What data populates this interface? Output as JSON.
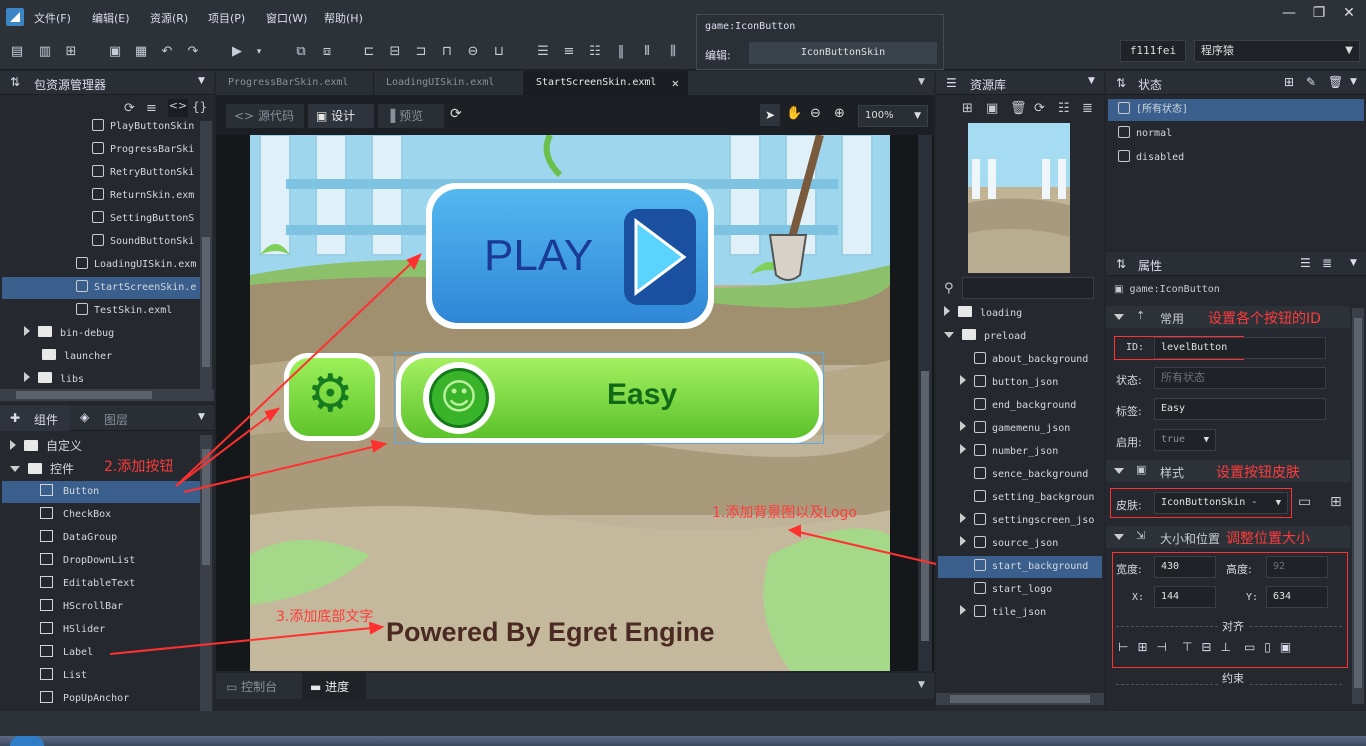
{
  "menu": {
    "items": [
      "文件(F)",
      "编辑(E)",
      "资源(R)",
      "项目(P)",
      "窗口(W)",
      "帮助(H)"
    ]
  },
  "toolbar": {
    "user": "f111fei",
    "role": "程序猿"
  },
  "tooltip": {
    "title": "game:IconButton",
    "label": "编辑:",
    "value": "IconButtonSkin"
  },
  "left_panel": {
    "title": "包资源管理器",
    "files": [
      "PlayButtonSkin",
      "ProgressBarSki",
      "RetryButtonSki",
      "ReturnSkin.exm",
      "SettingButtonS",
      "SoundButtonSki",
      "LoadingUISkin.exm",
      "StartScreenSkin.e",
      "TestSkin.exml"
    ],
    "folders": [
      "bin-debug",
      "launcher",
      "libs"
    ]
  },
  "components_panel": {
    "tab1": "组件",
    "tab2": "图层",
    "groups": [
      "自定义",
      "控件"
    ],
    "items": [
      "Button",
      "CheckBox",
      "DataGroup",
      "DropDownList",
      "EditableText",
      "HScrollBar",
      "HSlider",
      "Label",
      "List",
      "PopUpAnchor"
    ]
  },
  "editor": {
    "tabs": [
      "ProgressBarSkin.exml",
      "LoadingUISkin.exml",
      "StartScreenSkin.exml"
    ],
    "mode_source": "源代码",
    "mode_design": "设计",
    "mode_preview": "预览",
    "zoom": "100%",
    "canvas": {
      "play_label": "PLAY",
      "easy_label": "Easy",
      "footer": "Powered By Egret Engine"
    },
    "bottom_tabs": [
      "控制台",
      "进度"
    ]
  },
  "annotations": {
    "add_button": "2.添加按钮",
    "add_bg": "1.添加背景图以及Logo",
    "add_text": "3.添加底部文字",
    "set_id": "设置各个按钮的ID",
    "set_skin": "设置按钮皮肤",
    "adjust": "调整位置大小"
  },
  "assets_panel": {
    "title": "资源库",
    "folders": [
      "loading",
      "preload"
    ],
    "items": [
      "about_background",
      "button_json",
      "end_background",
      "gamemenu_json",
      "number_json",
      "sence_background",
      "setting_backgroun",
      "settingscreen_jso",
      "source_json",
      "start_background",
      "start_logo",
      "tile_json"
    ]
  },
  "states_panel": {
    "title": "状态",
    "states": [
      "[所有状态]",
      "normal",
      "disabled"
    ]
  },
  "props_panel": {
    "title": "属性",
    "component": "game:IconButton",
    "section_common": "常用",
    "id_label": "ID:",
    "id_value": "levelButton",
    "state_label": "状态:",
    "state_placeholder": "所有状态",
    "label_label": "标签:",
    "label_value": "Easy",
    "enabled_label": "启用:",
    "enabled_value": "true",
    "section_style": "样式",
    "skin_label": "皮肤:",
    "skin_value": "IconButtonSkin -",
    "section_size": "大小和位置",
    "width_label": "宽度:",
    "width_value": "430",
    "height_label": "高度:",
    "height_value": "92",
    "x_label": "X:",
    "x_value": "144",
    "y_label": "Y:",
    "y_value": "634",
    "align_label": "对齐",
    "constraint_label": "约束"
  }
}
